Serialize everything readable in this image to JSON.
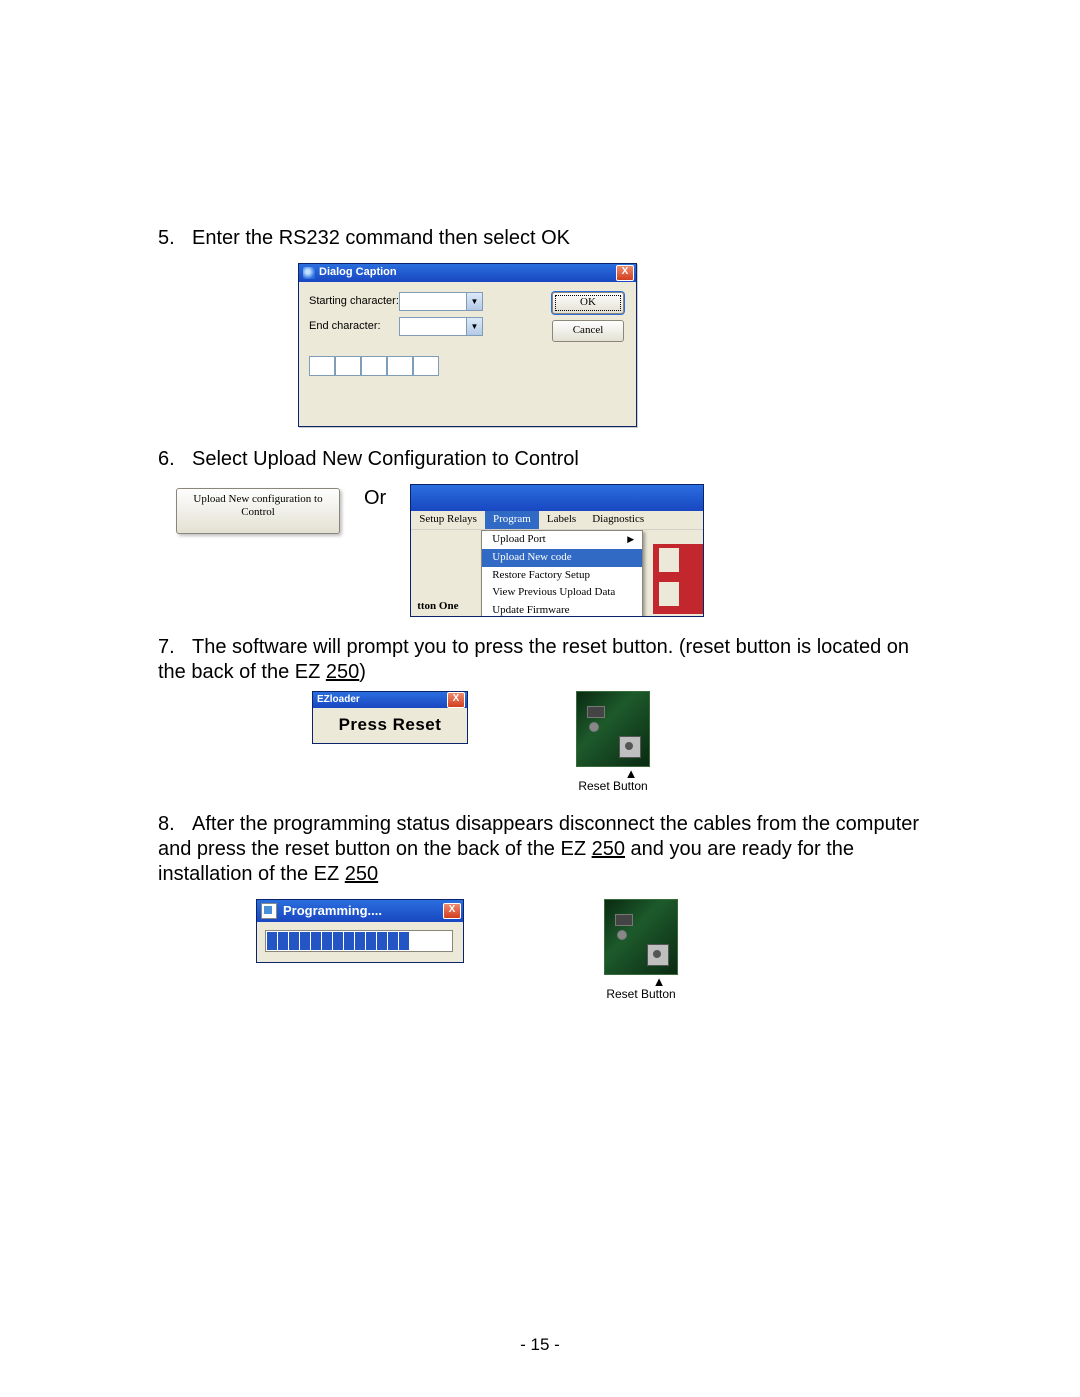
{
  "steps": {
    "s5": {
      "num": "5.",
      "text": "Enter the RS232 command then select OK"
    },
    "s6": {
      "num": "6.",
      "text": "Select  Upload New Configuration to Control"
    },
    "s7": {
      "num": "7.",
      "text_a": "The software will prompt you to press the reset button. (reset button is located on the back of  the EZ ",
      "link": "250",
      "text_b": ")"
    },
    "s8": {
      "num": "8.",
      "text_a": "After the programming status disappears disconnect the cables from the computer and press the reset button on the back of the EZ ",
      "link1": "250",
      "text_b": " and you are ready for the installation of the EZ ",
      "link2": "250"
    }
  },
  "dialog5": {
    "title": "Dialog Caption",
    "label_start": "Starting character:",
    "label_end": "End character:",
    "ok": "OK",
    "cancel": "Cancel"
  },
  "step6": {
    "upload_btn": "Upload New configuration to Control",
    "or": "Or",
    "tabs": {
      "setup": "Setup Relays",
      "program": "Program",
      "labels": "Labels",
      "diag": "Diagnostics"
    },
    "menu": {
      "upload_port": "Upload Port",
      "upload_new": "Upload New code",
      "restore": "Restore Factory Setup",
      "view_prev": "View Previous Upload Data",
      "update_fw": "Update Firmware"
    },
    "tton": "tton One"
  },
  "step7": {
    "ez_title": "EZloader",
    "press_reset": "Press Reset",
    "reset_caption": "Reset Button"
  },
  "step8": {
    "prog_title": "Programming....",
    "reset_caption": "Reset Button"
  },
  "footer": "- 15 -",
  "close_x": "X"
}
